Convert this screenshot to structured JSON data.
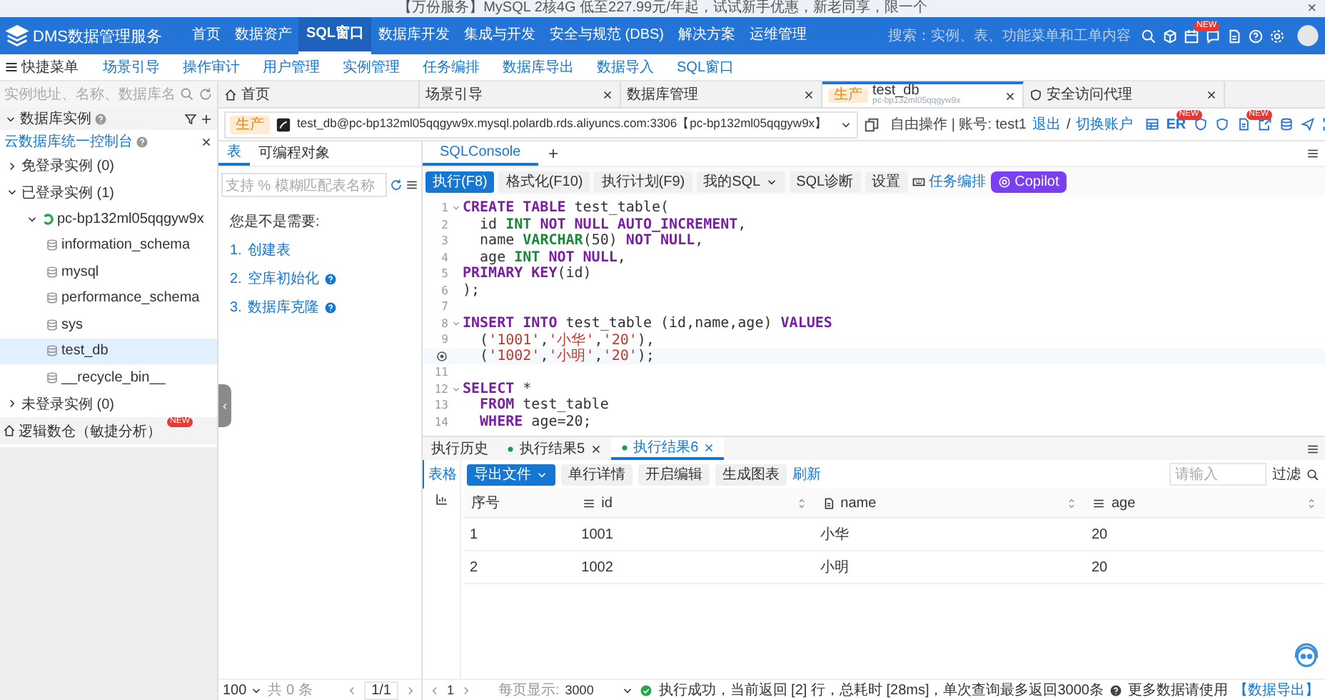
{
  "banner": {
    "text": "【万份服务】MySQL 2核4G 低至227.99元/年起，试试新手优惠，新老同享，限一个",
    "close": "×"
  },
  "header": {
    "product": "DMS数据管理服务",
    "nav": [
      {
        "label": "首页",
        "selected": false
      },
      {
        "label": "数据资产",
        "selected": false
      },
      {
        "label": "SQL窗口",
        "selected": true
      },
      {
        "label": "数据库开发",
        "selected": false
      },
      {
        "label": "集成与开发",
        "selected": false
      },
      {
        "label": "安全与规范 (DBS)",
        "selected": false
      },
      {
        "label": "解决方案",
        "selected": false
      },
      {
        "label": "运维管理",
        "selected": false
      }
    ],
    "search_placeholder": "搜索：实例、表、功能菜单和工单内容",
    "badge": "NEW"
  },
  "quick_menu": {
    "label": "快捷菜单",
    "items": [
      "场景引导",
      "操作审计",
      "用户管理",
      "实例管理",
      "任务编排",
      "数据库导出",
      "数据导入",
      "SQL窗口"
    ]
  },
  "sidebar": {
    "search_placeholder": "实例地址、名称、数据库名",
    "section": "数据库实例",
    "console_link": "云数据库统一控制台",
    "tree": [
      {
        "label": "免登录实例 (0)",
        "expanded": false
      },
      {
        "label": "已登录实例 (1)",
        "expanded": true,
        "children": [
          {
            "label": "pc-bp132ml05qqgyw9x",
            "expanded": true,
            "children": [
              {
                "label": "information_schema",
                "selected": false
              },
              {
                "label": "mysql",
                "selected": false
              },
              {
                "label": "performance_schema",
                "selected": false
              },
              {
                "label": "sys",
                "selected": false
              },
              {
                "label": "test_db",
                "selected": true
              },
              {
                "label": "__recycle_bin__",
                "selected": false
              }
            ]
          }
        ]
      },
      {
        "label": "未登录实例 (0)",
        "expanded": false
      }
    ],
    "warehouse": {
      "label": "逻辑数仓（敏捷分析）",
      "badge": "NEW"
    }
  },
  "tabs": [
    {
      "kind": "home",
      "label": "首页",
      "selected": false,
      "closable": false
    },
    {
      "kind": "page",
      "label": "场景引导",
      "selected": false,
      "closable": true
    },
    {
      "kind": "page",
      "label": "数据库管理",
      "selected": false,
      "closable": true
    },
    {
      "kind": "db",
      "env": "生产",
      "label": "test_db",
      "subtitle": "pc-bp132ml05qqgyw9x",
      "selected": true,
      "closable": true
    },
    {
      "kind": "proxy",
      "label": "安全访问代理",
      "selected": false,
      "closable": true
    }
  ],
  "connection": {
    "env": "生产",
    "text": "test_db@pc-bp132ml05qqgyw9x.mysql.polardb.rds.aliyuncs.com:3306【pc-bp132ml05qqgyw9x】",
    "mode": "自由操作 | 账号: test1",
    "logout": "退出",
    "separator": "/",
    "switch": "切换账户",
    "er": "ER",
    "er_badge": "NEW",
    "doc_badge": "NEW"
  },
  "objects": {
    "tabs": [
      {
        "label": "表",
        "selected": true
      },
      {
        "label": "可编程对象",
        "selected": false
      }
    ],
    "search_placeholder": "支持 % 模糊匹配表名称",
    "hint": "您是不是需要:",
    "suggestions": [
      {
        "num": "1.",
        "label": "创建表",
        "help": false
      },
      {
        "num": "2.",
        "label": "空库初始化",
        "help": true
      },
      {
        "num": "3.",
        "label": "数据库克隆",
        "help": true
      }
    ],
    "pager": {
      "size": "100",
      "total": "共 0 条",
      "page": "1/1"
    }
  },
  "editor": {
    "tabs": [
      {
        "label": "SQLConsole",
        "selected": true
      }
    ],
    "toolbar": [
      {
        "kind": "primary",
        "label": "执行(F8)"
      },
      {
        "kind": "plain",
        "label": "格式化(F10)"
      },
      {
        "kind": "plain",
        "label": "执行计划(F9)"
      },
      {
        "kind": "dropdown",
        "label": "我的SQL"
      },
      {
        "kind": "plain",
        "label": "SQL诊断"
      },
      {
        "kind": "plain",
        "label": "设置"
      },
      {
        "kind": "icon"
      },
      {
        "kind": "link",
        "label": "任务编排"
      },
      {
        "kind": "copilot",
        "label": "Copilot"
      }
    ],
    "lines": [
      {
        "no": "1",
        "fold": true,
        "tokens": [
          {
            "kind": "keyword",
            "text": "CREATE TABLE"
          },
          {
            "kind": "plain",
            "text": " test_table("
          }
        ]
      },
      {
        "no": "2",
        "tokens": [
          {
            "kind": "plain",
            "text": "  id "
          },
          {
            "kind": "type",
            "text": "INT"
          },
          {
            "kind": "keyword",
            "text": " NOT NULL AUTO_INCREMENT"
          },
          {
            "kind": "plain",
            "text": ","
          }
        ]
      },
      {
        "no": "3",
        "tokens": [
          {
            "kind": "plain",
            "text": "  name "
          },
          {
            "kind": "type",
            "text": "VARCHAR"
          },
          {
            "kind": "plain",
            "text": "(50) "
          },
          {
            "kind": "keyword",
            "text": "NOT NULL"
          },
          {
            "kind": "plain",
            "text": ","
          }
        ]
      },
      {
        "no": "4",
        "tokens": [
          {
            "kind": "plain",
            "text": "  age "
          },
          {
            "kind": "type",
            "text": "INT"
          },
          {
            "kind": "keyword",
            "text": " NOT NULL"
          },
          {
            "kind": "plain",
            "text": ","
          }
        ]
      },
      {
        "no": "5",
        "tokens": [
          {
            "kind": "keyword",
            "text": "PRIMARY KEY"
          },
          {
            "kind": "plain",
            "text": "(id)"
          }
        ]
      },
      {
        "no": "6",
        "tokens": [
          {
            "kind": "plain",
            "text": ");"
          }
        ]
      },
      {
        "no": "7"
      },
      {
        "no": "8",
        "fold": true,
        "tokens": [
          {
            "kind": "keyword",
            "text": "INSERT INTO"
          },
          {
            "kind": "plain",
            "text": " test_table (id,name,age) "
          },
          {
            "kind": "keyword",
            "text": "VALUES"
          }
        ]
      },
      {
        "no": "9",
        "tokens": [
          {
            "kind": "plain",
            "text": "  ("
          },
          {
            "kind": "string",
            "text": "'1001'"
          },
          {
            "kind": "plain",
            "text": ","
          },
          {
            "kind": "string",
            "text": "'小华'"
          },
          {
            "kind": "plain",
            "text": ","
          },
          {
            "kind": "string",
            "text": "'20'"
          },
          {
            "kind": "plain",
            "text": "),"
          }
        ]
      },
      {
        "current": true,
        "tokens": [
          {
            "kind": "plain",
            "text": "  ("
          },
          {
            "kind": "string",
            "text": "'1002'"
          },
          {
            "kind": "plain",
            "text": ","
          },
          {
            "kind": "string",
            "text": "'小明'"
          },
          {
            "kind": "plain",
            "text": ","
          },
          {
            "kind": "string",
            "text": "'20'"
          },
          {
            "kind": "plain",
            "text": ");"
          }
        ]
      },
      {
        "no": "11"
      },
      {
        "no": "12",
        "fold": true,
        "tokens": [
          {
            "kind": "keyword",
            "text": "SELECT"
          },
          {
            "kind": "plain",
            "text": " *"
          }
        ]
      },
      {
        "no": "13",
        "tokens": [
          {
            "kind": "keyword",
            "text": "  FROM"
          },
          {
            "kind": "plain",
            "text": " test_table"
          }
        ]
      },
      {
        "no": "14",
        "tokens": [
          {
            "kind": "keyword",
            "text": "  WHERE"
          },
          {
            "kind": "plain",
            "text": " age=20;"
          }
        ]
      }
    ]
  },
  "results": {
    "tabs": [
      {
        "label": "执行历史",
        "dot": false,
        "closable": false,
        "selected": false
      },
      {
        "label": "执行结果5",
        "dot": true,
        "closable": true,
        "selected": false
      },
      {
        "label": "执行结果6",
        "dot": true,
        "closable": true,
        "selected": true
      }
    ],
    "views": [
      {
        "kind": "table",
        "label": "表格",
        "selected": true
      },
      {
        "kind": "chart",
        "selected": false
      }
    ],
    "toolbar": [
      {
        "kind": "dropdown",
        "label": "导出文件"
      },
      {
        "kind": "plain",
        "label": "单行详情"
      },
      {
        "kind": "plain",
        "label": "开启编辑"
      },
      {
        "kind": "plain",
        "label": "生成图表"
      },
      {
        "kind": "link",
        "label": "刷新"
      }
    ],
    "filter_placeholder": "请输入",
    "filter": "过滤",
    "table": {
      "columns": [
        {
          "kind": "index",
          "label": "序号"
        },
        {
          "kind": "number",
          "label": "id"
        },
        {
          "kind": "text",
          "label": "name"
        },
        {
          "kind": "number",
          "label": "age"
        }
      ],
      "rows": [
        [
          "1",
          "1001",
          "小华",
          "20"
        ],
        [
          "2",
          "1002",
          "小明",
          "20"
        ]
      ]
    }
  },
  "status_bar": {
    "page": "1",
    "page_size_label": "每页显示:",
    "page_size": "3000",
    "message": "执行成功，当前返回 [2] 行，总耗时 [28ms]，单次查询最多返回3000条",
    "more": "更多数据请使用",
    "export_link": "【数据导出】"
  }
}
